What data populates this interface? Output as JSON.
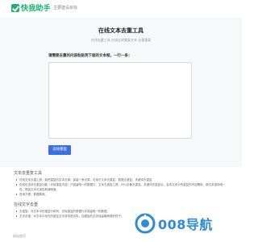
{
  "header": {
    "logo_name": "快我助手",
    "logo_sub": "主要建设目标"
  },
  "main": {
    "title": "在线文本去重工具",
    "subtitle": "在线去重工具 在线去除重复文本 去重重复",
    "prompt": "请需要去重的内容粘贴到下面的文本框，一行一条：",
    "textarea_value": "",
    "textarea_placeholder": "",
    "button_label": "去除重复"
  },
  "section1": {
    "title": "文本去重复工具",
    "bullets": [
      "在线文本去重工具，能把重复的文本去掉，保留一条记录，可用于文本去重复，数据去重复，关键词去重复",
      "在线也支持去重复功能（去除重复内容）只保留唯一的数据行，文本去重复工具，SEO必备去重复，关键词去重复后，会将文本中的重复的内容删除，使文本保持唯一性，提高文本可读性和清晰度。",
      "查询方便，数据精简。"
    ]
  },
  "section2": {
    "title": "在线文字去重",
    "bullets": [
      "去重复：对文本中的重复行和列，去除重复的数据行并保留唯一的数据。",
      "文字去重：对文本中存在的重复文字或词语去除，加重复的文本保留最精简的样子。"
    ]
  },
  "footer": {
    "text": "网站首页"
  },
  "watermark": {
    "text": "008导航"
  },
  "colors": {
    "brand_green": "#19b26b",
    "button_blue": "#3b6fde",
    "watermark_blue": "#2d8cd4"
  }
}
